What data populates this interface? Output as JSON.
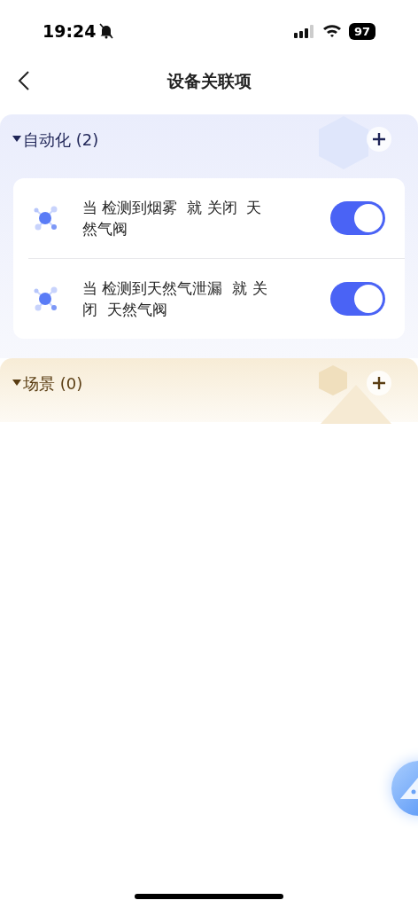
{
  "status_bar": {
    "time": "19:24",
    "battery": "97"
  },
  "nav": {
    "title": "设备关联项"
  },
  "automation": {
    "title": "自动化 (2)",
    "expanded": true,
    "items": [
      {
        "text": "当 检测到烟雾  就 关闭  天然气阀",
        "on": true
      },
      {
        "text": "当 检测到天然气泄漏  就 关闭  天然气阀",
        "on": true
      }
    ]
  },
  "scenes": {
    "title": "场景 (0)",
    "expanded": true
  }
}
